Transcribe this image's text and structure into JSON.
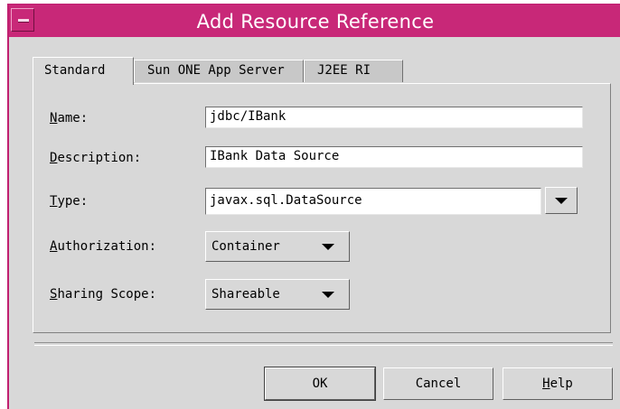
{
  "window": {
    "title": "Add Resource Reference",
    "accent_color": "#c82878"
  },
  "tabs": [
    {
      "label": "Standard",
      "active": true
    },
    {
      "label": "Sun ONE App Server",
      "active": false
    },
    {
      "label": "J2EE RI",
      "active": false
    }
  ],
  "form": {
    "name": {
      "mnemonic": "N",
      "rest": "ame:",
      "value": "jdbc/IBank"
    },
    "description": {
      "mnemonic": "D",
      "rest": "escription:",
      "value": "IBank Data Source"
    },
    "type": {
      "mnemonic": "T",
      "rest": "ype:",
      "value": "javax.sql.DataSource",
      "icon": "chevron-down-icon"
    },
    "authorization": {
      "mnemonic": "A",
      "rest": "uthorization:",
      "value": "Container",
      "icon": "chevron-down-icon"
    },
    "sharing_scope": {
      "mnemonic": "S",
      "rest": "haring Scope:",
      "value": "Shareable",
      "icon": "chevron-down-icon"
    }
  },
  "buttons": {
    "ok": "OK",
    "cancel": "Cancel",
    "help_mnemonic": "H",
    "help_rest": "elp"
  }
}
